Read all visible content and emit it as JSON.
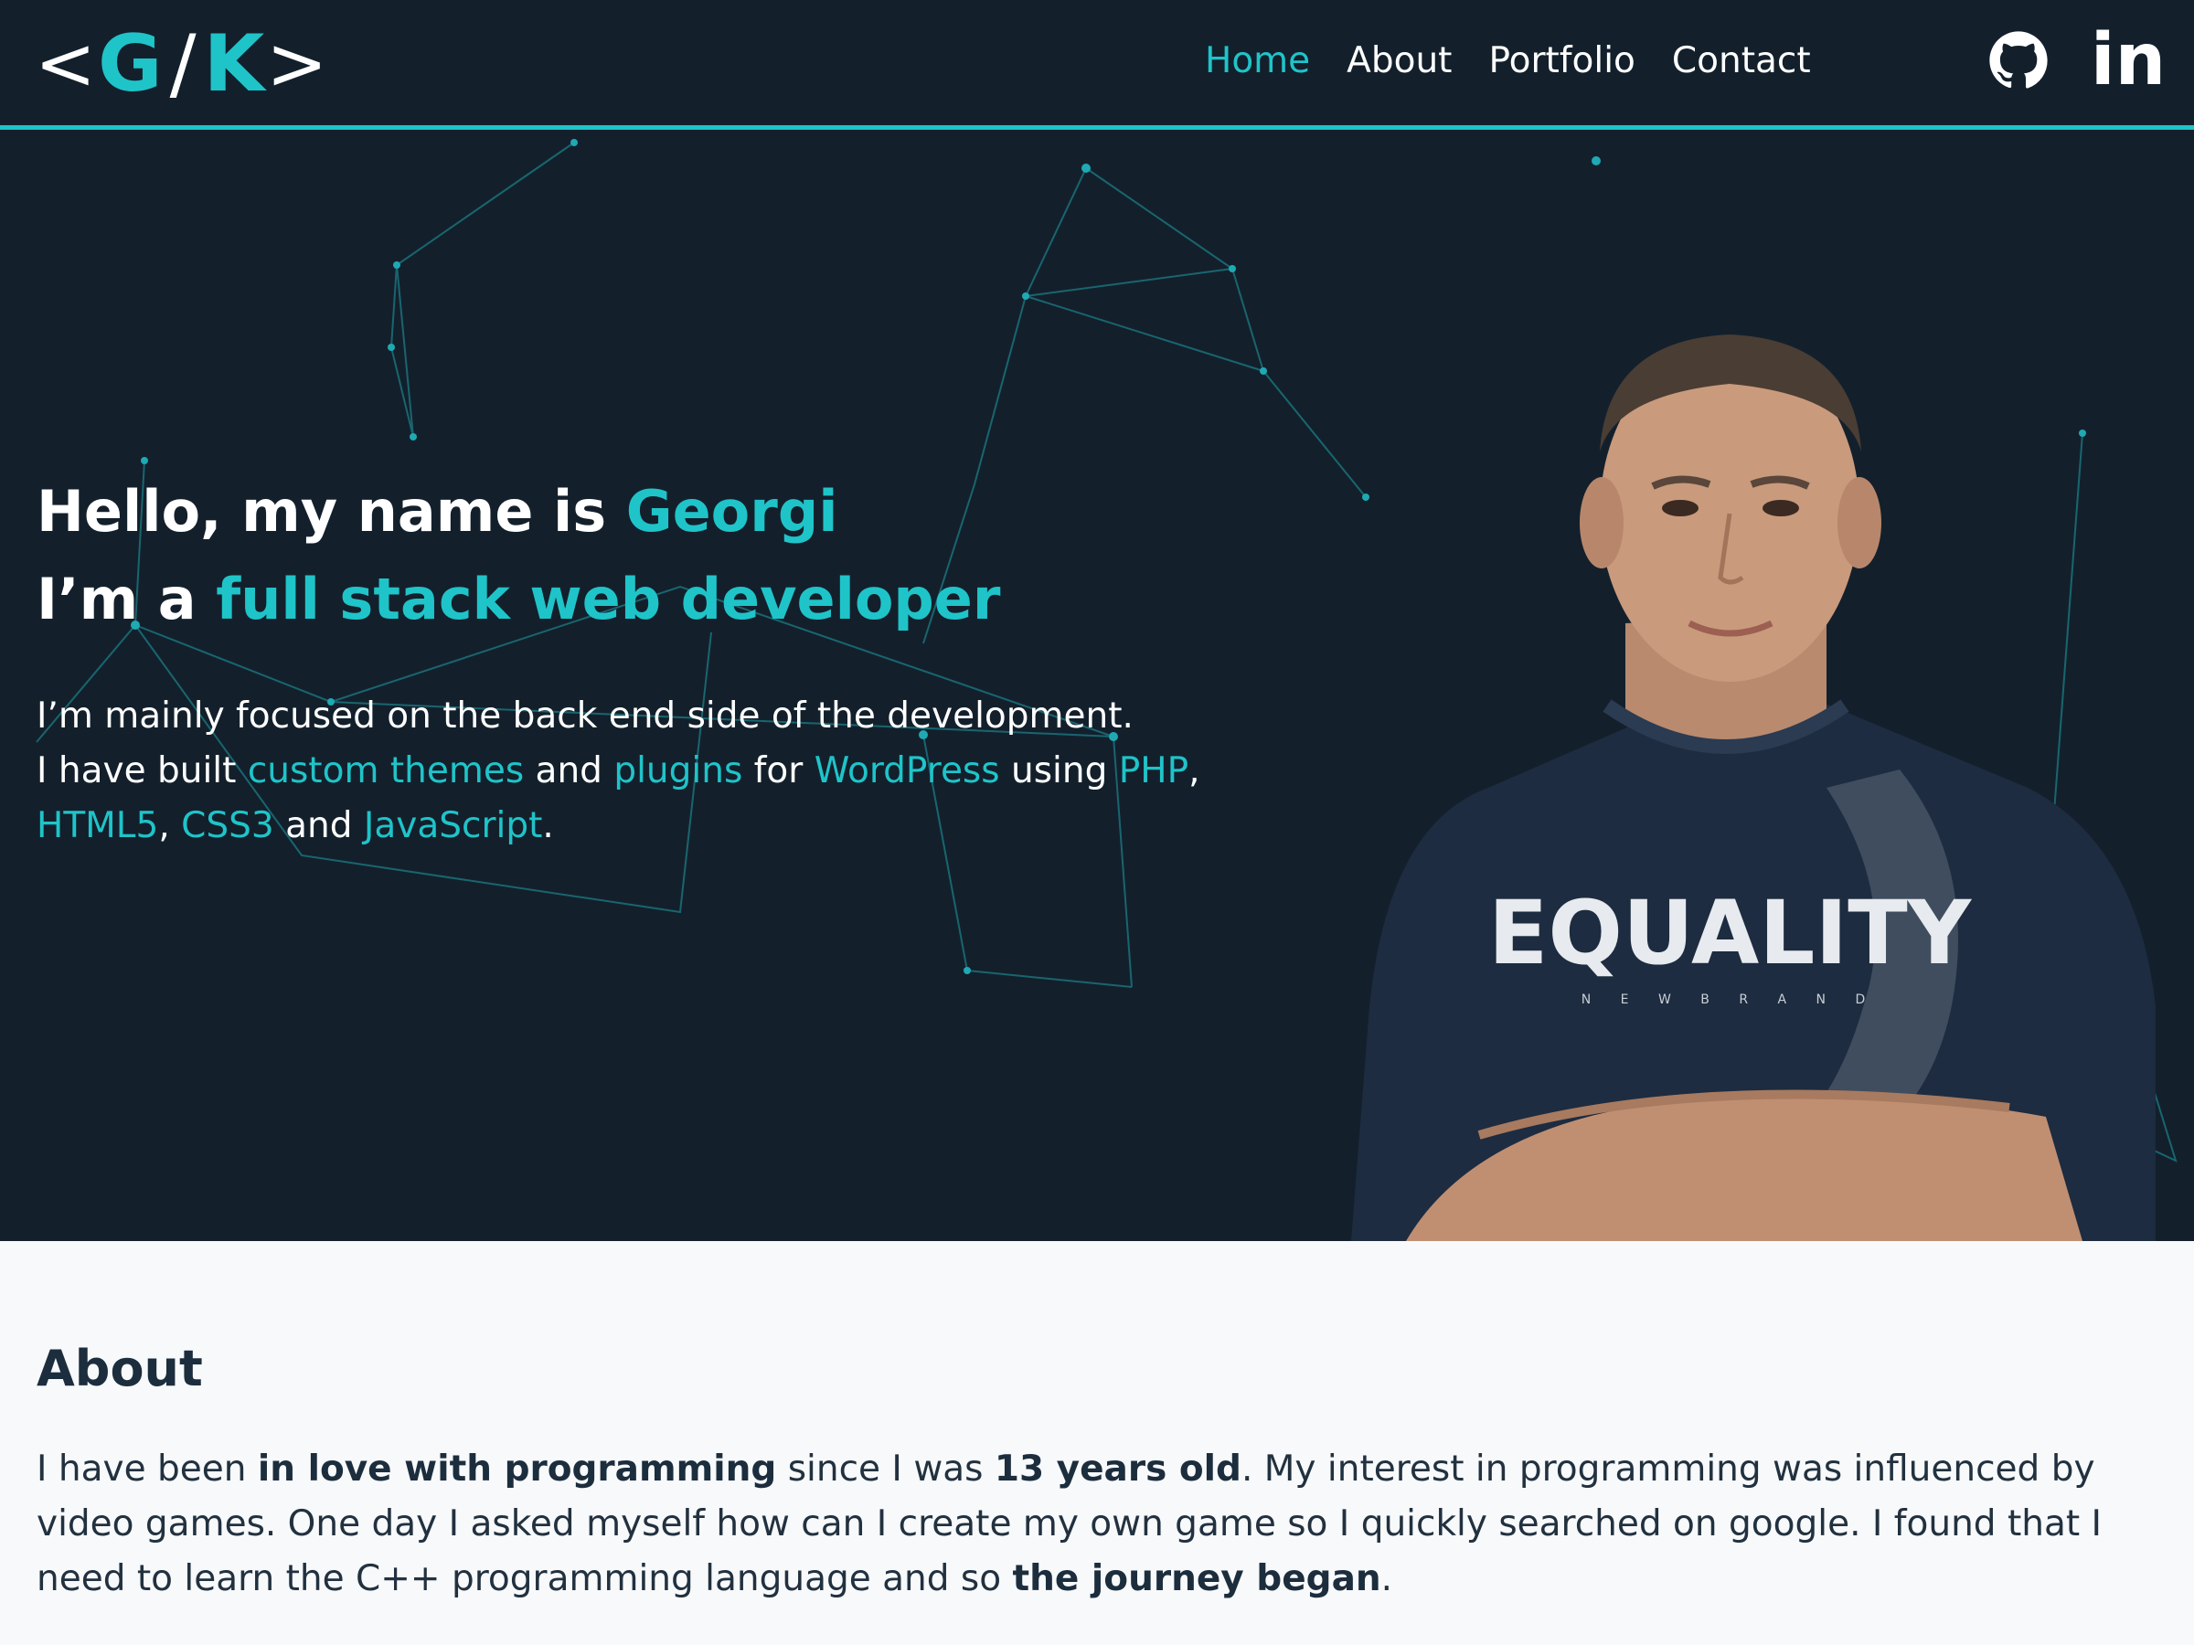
{
  "colors": {
    "accent": "#1fc4c9",
    "dark_bg": "#13202c",
    "light_bg": "#f7f9fb",
    "text_dark": "#1c2d3d"
  },
  "logo": {
    "open": "<",
    "g": "G",
    "slash": "/",
    "k": "K",
    "close": ">"
  },
  "nav": [
    {
      "label": "Home",
      "active": true
    },
    {
      "label": "About",
      "active": false
    },
    {
      "label": "Portfolio",
      "active": false
    },
    {
      "label": "Contact",
      "active": false
    }
  ],
  "social": {
    "github_icon": "github-icon",
    "linkedin_text": "in"
  },
  "hero": {
    "line1_prefix": "Hello, my name is ",
    "line1_name": "Georgi",
    "line2_prefix": "I’m a ",
    "line2_role": "full stack web developer",
    "p1": "I’m mainly focused on the back end side of the development.",
    "p2_a": "I have built ",
    "p2_link1": "custom themes",
    "p2_b": " and ",
    "p2_link2": "plugins",
    "p2_c": " for ",
    "p2_link3": "WordPress",
    "p2_d": " using ",
    "p2_link4": "PHP",
    "p2_e": ",",
    "p3_link1": "HTML5",
    "p3_a": ", ",
    "p3_link2": "CSS3",
    "p3_b": " and ",
    "p3_link3": "JavaScript",
    "p3_c": ".",
    "shirt_text": "EQUALITY",
    "shirt_sub": "N E W B R A N D"
  },
  "about": {
    "title": "About",
    "t1": "I have been ",
    "b1": "in love with programming",
    "t2": " since I was ",
    "b2": "13 years old",
    "t3": ". My interest in programming was influenced by video games. One day I asked myself how can I create my own game so I quickly searched on google. I found that I need to learn the C++ programming language and so ",
    "b3": "the journey began",
    "t4": "."
  }
}
